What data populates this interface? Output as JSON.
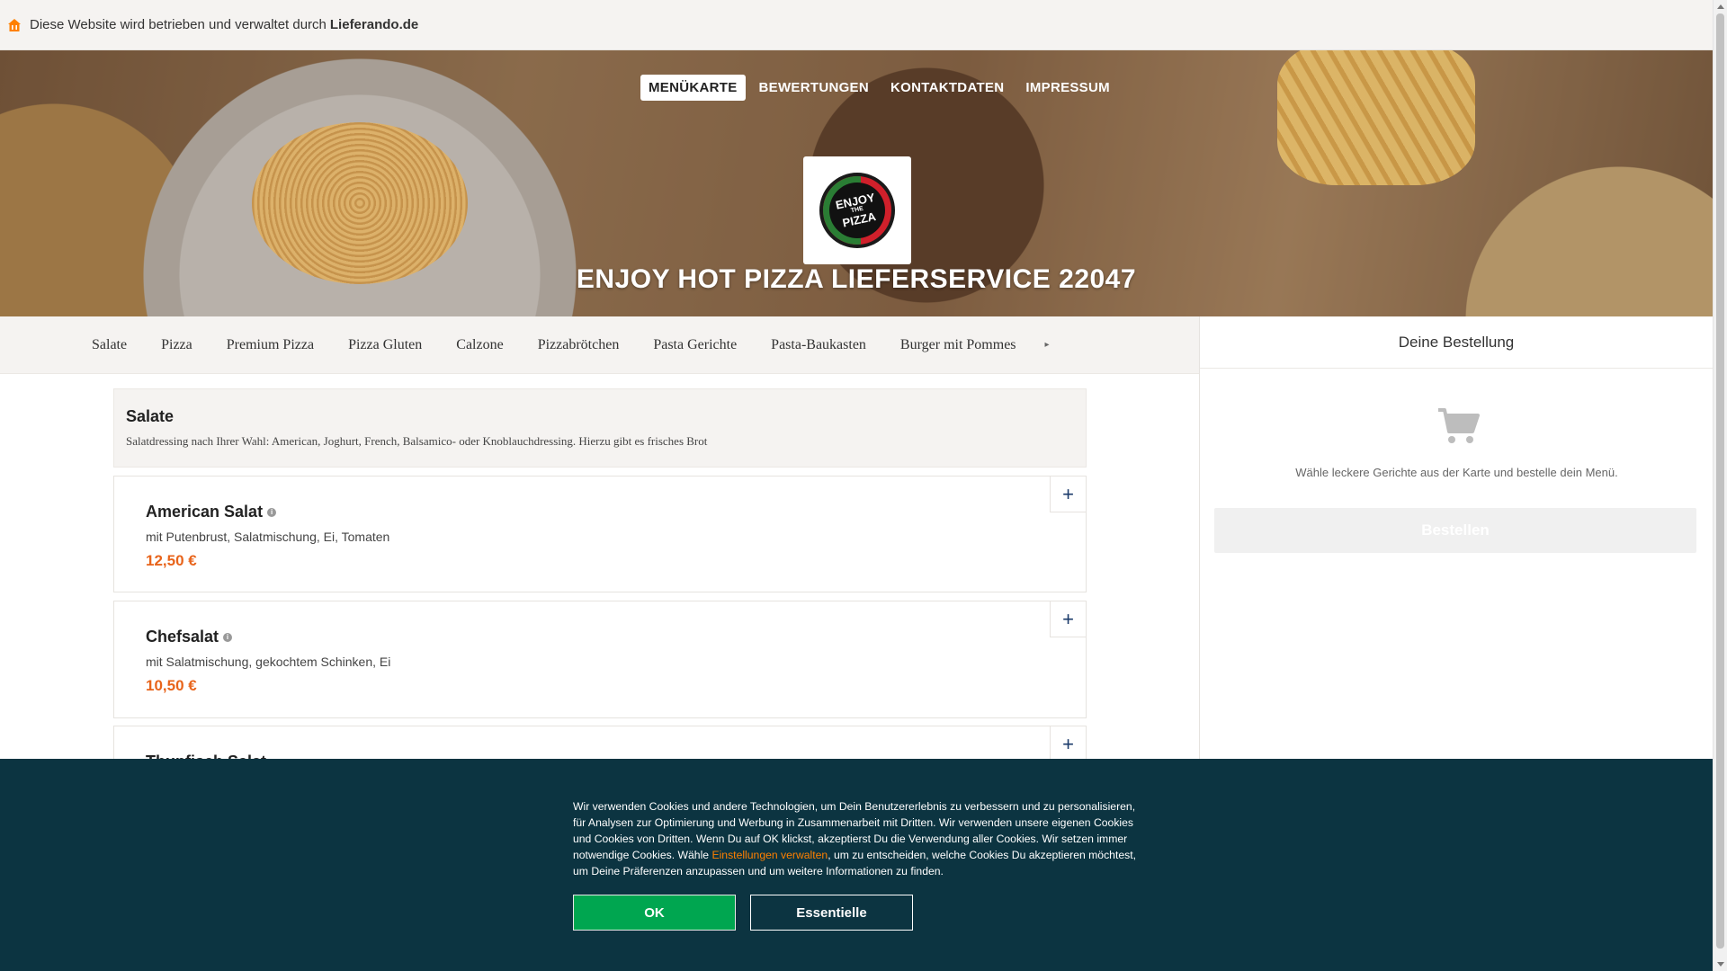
{
  "notice": {
    "text": "Diese Website wird betrieben und verwaltet durch",
    "brand": "Lieferando.de",
    "icon": "lieferando-house-icon"
  },
  "nav": {
    "items": [
      "MENÜKARTE",
      "BEWERTUNGEN",
      "KONTAKTDATEN",
      "IMPRESSUM"
    ],
    "active": "MENÜKARTE"
  },
  "restaurant": {
    "name": "ENJOY HOT PIZZA LIEFERSERVICE 22047",
    "logo_top": "ENJOY",
    "logo_mid": "THE",
    "logo_bottom": "PIZZA"
  },
  "categories": [
    "Salate",
    "Pizza",
    "Premium Pizza",
    "Pizza Gluten",
    "Calzone",
    "Pizzabrötchen",
    "Pasta Gerichte",
    "Pasta-Baukasten",
    "Burger mit Pommes"
  ],
  "section": {
    "title": "Salate",
    "description": "Salatdressing nach Ihrer Wahl: American, Joghurt, French, Balsamico- oder Knoblauchdressing. Hierzu gibt es frisches Brot"
  },
  "dishes": [
    {
      "name": "American Salat",
      "description": "mit Putenbrust, Salatmischung, Ei, Tomaten",
      "price": "12,50 €"
    },
    {
      "name": "Chefsalat",
      "description": "mit Salatmischung, gekochtem Schinken, Ei",
      "price": "10,50 €"
    },
    {
      "name": "Thunfisch Salat",
      "description": "",
      "price": ""
    }
  ],
  "order": {
    "title": "Deine Bestellung",
    "empty_text": "Wähle leckere Gerichte aus der Karte und bestelle dein Menü.",
    "button": "Bestellen"
  },
  "cookie": {
    "text_before": "Wir verwenden Cookies und andere Technologien, um Dein Benutzererlebnis zu verbessern und zu personalisieren, für Analysen zur Optimierung und Werbung in Zusammenarbeit mit Dritten. Wir verwenden unsere eigenen Cookies und Cookies von Dritten. Wenn Du auf OK klickst, akzeptierst Du die Verwendung aller Cookies. Wir setzen immer notwendige Cookies. Wähle ",
    "link": "Einstellungen verwalten",
    "text_after": ", um zu entscheiden, welche Cookies Du akzeptieren möchtest, um Deine Präferenzen anzupassen und um weitere Informationen zu finden.",
    "ok": "OK",
    "essential": "Essentielle"
  },
  "colors": {
    "accent_orange": "#e8641b",
    "cookie_bg": "#0c3441",
    "ok_green": "#00a650"
  }
}
